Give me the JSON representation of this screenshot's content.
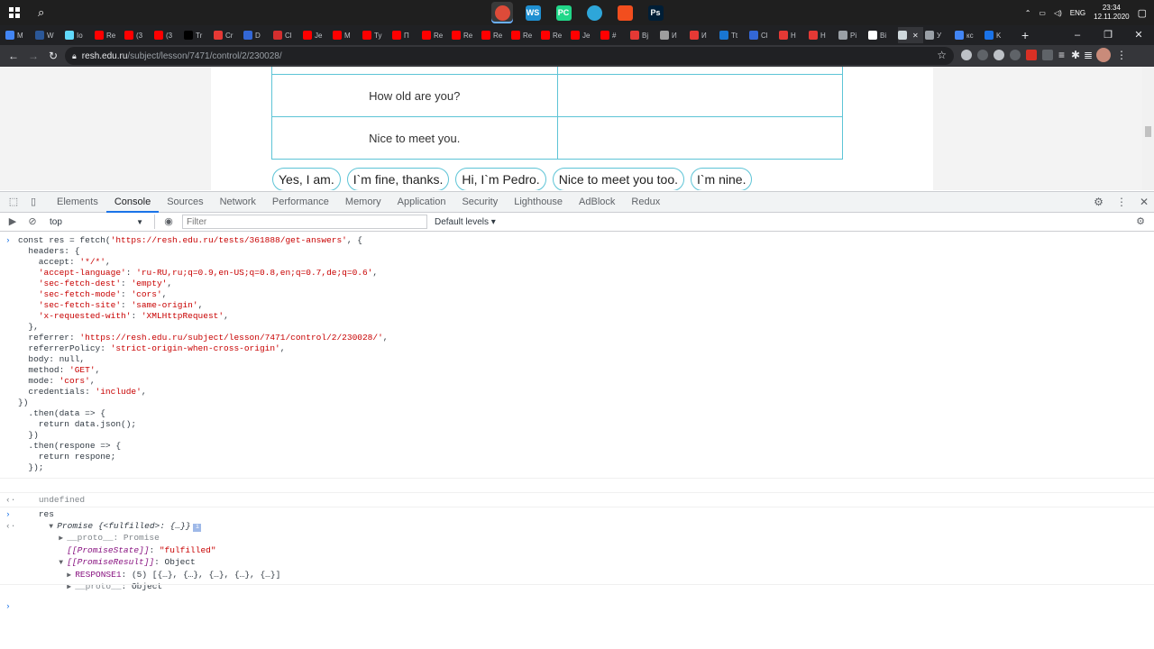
{
  "taskbar": {
    "apps": [
      {
        "icon": "chrome-icon",
        "color": "#dd4b39"
      },
      {
        "icon": "webstorm-icon",
        "label": "WS",
        "color": "#1f8fd1"
      },
      {
        "icon": "pycharm-icon",
        "label": "PC",
        "color": "#21d789"
      },
      {
        "icon": "telegram-icon",
        "color": "#2ea6d9"
      },
      {
        "icon": "figma-icon",
        "color": "#f24e1e"
      },
      {
        "icon": "photoshop-icon",
        "label": "Ps",
        "color": "#001e36"
      }
    ],
    "lang": "ENG",
    "time": "23:34",
    "date": "12.11.2020"
  },
  "tabs": [
    {
      "label": "M",
      "color": "#4285f4"
    },
    {
      "label": "W",
      "color": "#2b5797"
    },
    {
      "label": "Io",
      "color": "#61dafb"
    },
    {
      "label": "Re",
      "color": "#ff0000"
    },
    {
      "label": "(3",
      "color": "#ff0000"
    },
    {
      "label": "(3",
      "color": "#ff0000"
    },
    {
      "label": "Tr",
      "color": "#000000"
    },
    {
      "label": "Cr",
      "color": "#e53935"
    },
    {
      "label": "D",
      "color": "#3367d6"
    },
    {
      "label": "Cl",
      "color": "#d32f2f"
    },
    {
      "label": "Je",
      "color": "#ff0000"
    },
    {
      "label": "M",
      "color": "#ff0000"
    },
    {
      "label": "Ty",
      "color": "#ff0000"
    },
    {
      "label": "П",
      "color": "#ff0000"
    },
    {
      "label": "Re",
      "color": "#ff0000"
    },
    {
      "label": "Re",
      "color": "#ff0000"
    },
    {
      "label": "Re",
      "color": "#ff0000"
    },
    {
      "label": "Re",
      "color": "#ff0000"
    },
    {
      "label": "Re",
      "color": "#ff0000"
    },
    {
      "label": "Je",
      "color": "#ff0000"
    },
    {
      "label": "#",
      "color": "#ff0000"
    },
    {
      "label": "Bj",
      "color": "#e53935"
    },
    {
      "label": "И",
      "color": "#9e9e9e"
    },
    {
      "label": "И",
      "color": "#e53935"
    },
    {
      "label": "Tt",
      "color": "#1976d2"
    },
    {
      "label": "Cl",
      "color": "#3367d6"
    },
    {
      "label": "H",
      "color": "#e53935"
    },
    {
      "label": "H",
      "color": "#e53935"
    },
    {
      "label": "Pi",
      "color": "#9aa0a6"
    },
    {
      "label": "Bi",
      "color": "#ffffff"
    },
    {
      "label": "",
      "color": "#cfd8dc",
      "active": true
    },
    {
      "label": "У",
      "color": "#9aa0a6"
    },
    {
      "label": "кс",
      "color": "#4285f4"
    },
    {
      "label": "K",
      "color": "#1a73e8"
    }
  ],
  "omnibox": {
    "host": "resh.edu.ru",
    "path": "/subject/lesson/7471/control/2/230028/"
  },
  "page": {
    "rows": [
      {
        "left": "How old are you?",
        "right": ""
      },
      {
        "left": "Nice to meet you.",
        "right": ""
      }
    ],
    "chips": [
      "Yes, I am.",
      "I`m fine, thanks.",
      "Hi, I`m Pedro.",
      "Nice to meet you too.",
      "I`m nine."
    ]
  },
  "devtools": {
    "tabs": [
      "Elements",
      "Console",
      "Sources",
      "Network",
      "Performance",
      "Memory",
      "Application",
      "Security",
      "Lighthouse",
      "AdBlock",
      "Redux"
    ],
    "active_tab": "Console",
    "context": "top",
    "filter_placeholder": "Filter",
    "levels": "Default levels ▾"
  },
  "console": {
    "code_lines": [
      "const res = fetch('https://resh.edu.ru/tests/361888/get-answers', {",
      "  headers: {",
      "    accept: '*/*',",
      "    'accept-language': 'ru-RU,ru;q=0.9,en-US;q=0.8,en;q=0.7,de;q=0.6',",
      "    'sec-fetch-dest': 'empty',",
      "    'sec-fetch-mode': 'cors',",
      "    'sec-fetch-site': 'same-origin',",
      "    'x-requested-with': 'XMLHttpRequest',",
      "  },",
      "  referrer: 'https://resh.edu.ru/subject/lesson/7471/control/2/230028/',",
      "  referrerPolicy: 'strict-origin-when-cross-origin',",
      "  body: null,",
      "  method: 'GET',",
      "  mode: 'cors',",
      "  credentials: 'include',",
      "})",
      "  .then(data => {",
      "    return data.json();",
      "  })",
      "  .then(respone => {",
      "    return respone;",
      "  });"
    ],
    "undefined_text": "undefined",
    "res_cmd": "res",
    "promise_summary": "Promise {<fulfilled>: {…}}",
    "proto1": "__proto__: Promise",
    "state_key": "[[PromiseState]]",
    "state_val": "\"fulfilled\"",
    "result_key": "[[PromiseResult]]",
    "result_val": "Object",
    "response_key": "RESPONSE1",
    "response_val": "(5) [{…}, {…}, {…}, {…}, {…}]",
    "proto2_key": "__proto__",
    "proto2_val": "Object"
  }
}
